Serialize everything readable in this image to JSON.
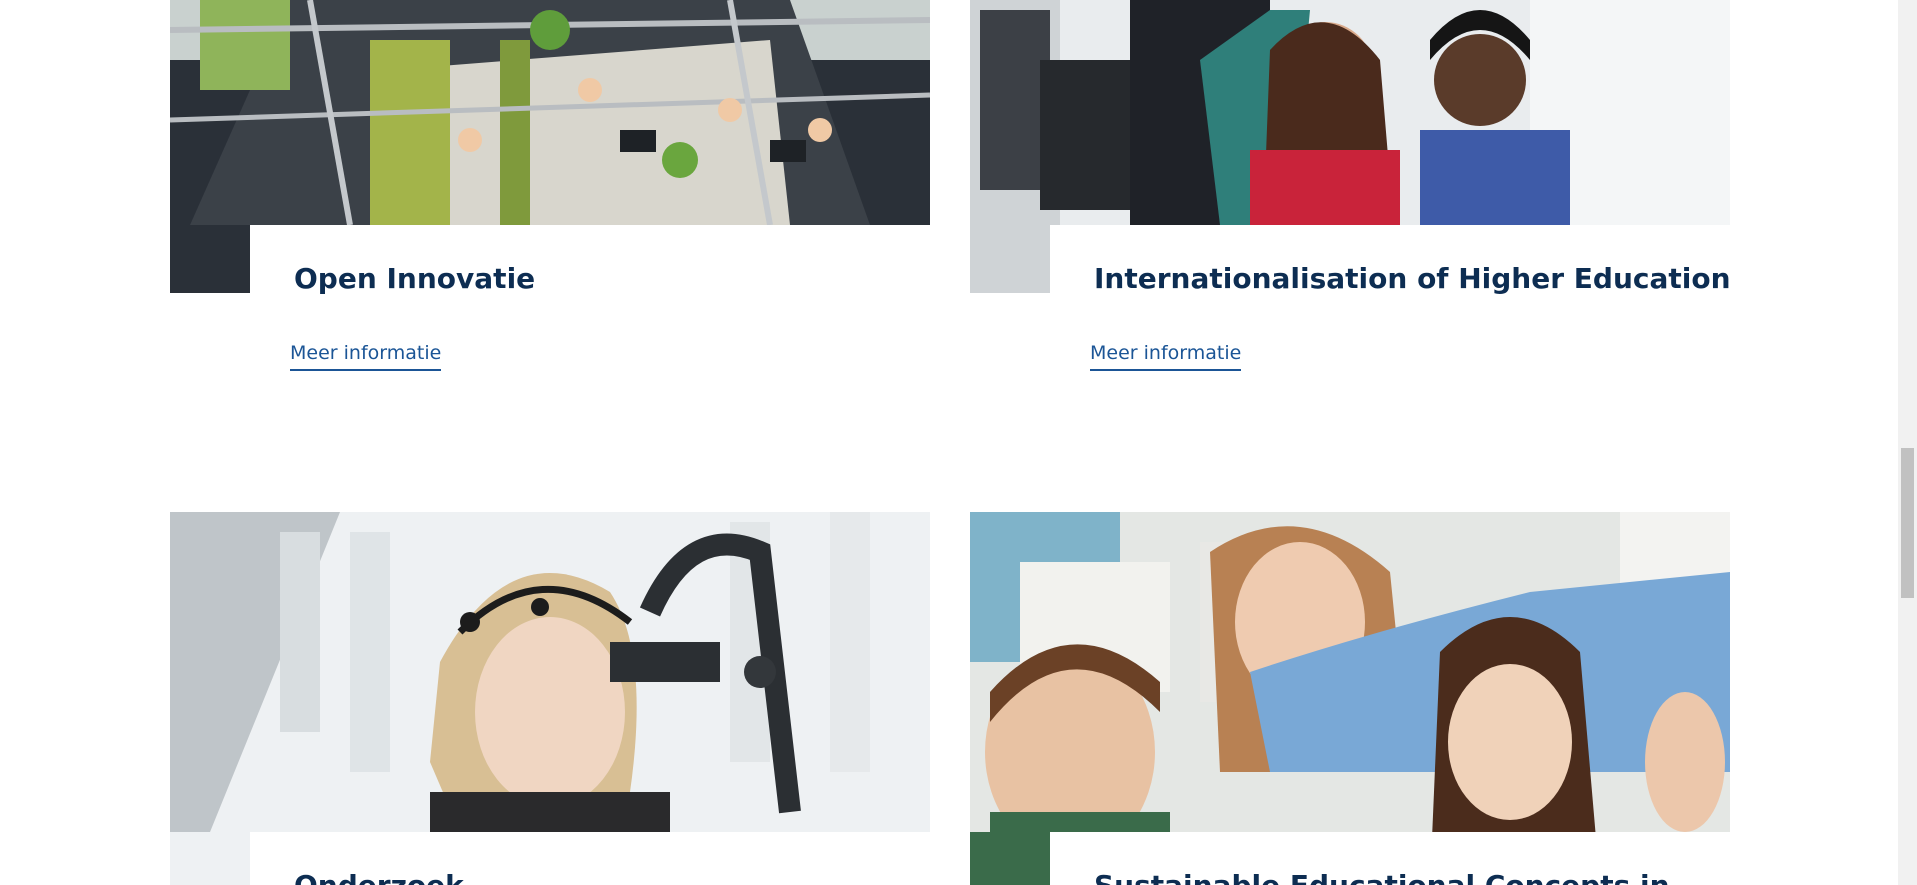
{
  "cards": [
    {
      "title": "Open Innovatie",
      "link_label": "Meer informatie",
      "image": "office-innovation-workspace"
    },
    {
      "title": "Internationalisation of Higher Education",
      "link_label": "Meer informatie",
      "image": "students-at-computers"
    },
    {
      "title": "Onderzoek",
      "image": "eeg-headset-research"
    },
    {
      "title": "Sustainable Educational Concepts in",
      "image": "teacher-with-students"
    }
  ],
  "colors": {
    "title": "#0d2d52",
    "link": "#1b5596",
    "background": "#ffffff"
  }
}
